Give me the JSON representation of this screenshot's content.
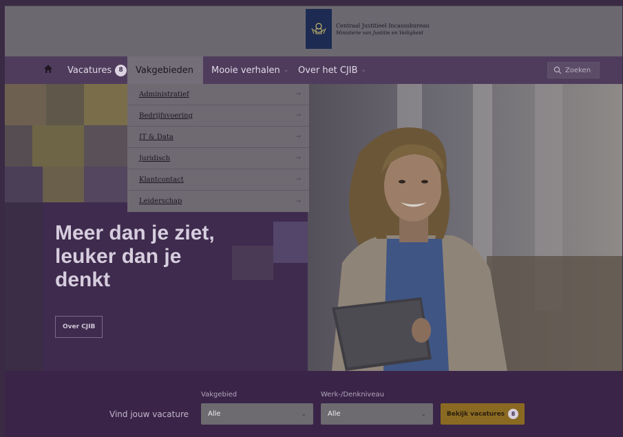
{
  "brand": {
    "line1": "Centraal Justitieel Incassobureau",
    "line2": "Ministerie van Justitie en Veiligheid",
    "logo_icon": "coat-of-arms-icon"
  },
  "nav": {
    "home_icon": "home-icon",
    "items": [
      {
        "label": "Vacatures",
        "badge": "8"
      },
      {
        "label": "Vakgebieden"
      },
      {
        "label": "Mooie verhalen"
      },
      {
        "label": "Over het CJIB"
      }
    ],
    "search_label": "Zoeken"
  },
  "dropdown": {
    "items": [
      {
        "label": "Administratief"
      },
      {
        "label": "Bedrijfsvoering"
      },
      {
        "label": "IT & Data"
      },
      {
        "label": "Juridisch"
      },
      {
        "label": "Klantcontact"
      },
      {
        "label": "Leiderschap"
      }
    ]
  },
  "hero": {
    "title_line1": "Meer dan je ziet,",
    "title_line2": "leuker dan je",
    "title_line3": "denkt",
    "button_label": "Over CJIB"
  },
  "search_band": {
    "title": "Vind jouw vacature",
    "field1_label": "Vakgebied",
    "field1_value": "Alle",
    "field2_label": "Werk-/Denkniveau",
    "field2_value": "Alle",
    "cta_label": "Bekijk vacatures",
    "cta_badge": "8"
  },
  "colors": {
    "brand_purple": "#3a2448",
    "cta_gold": "#8a6a22"
  }
}
